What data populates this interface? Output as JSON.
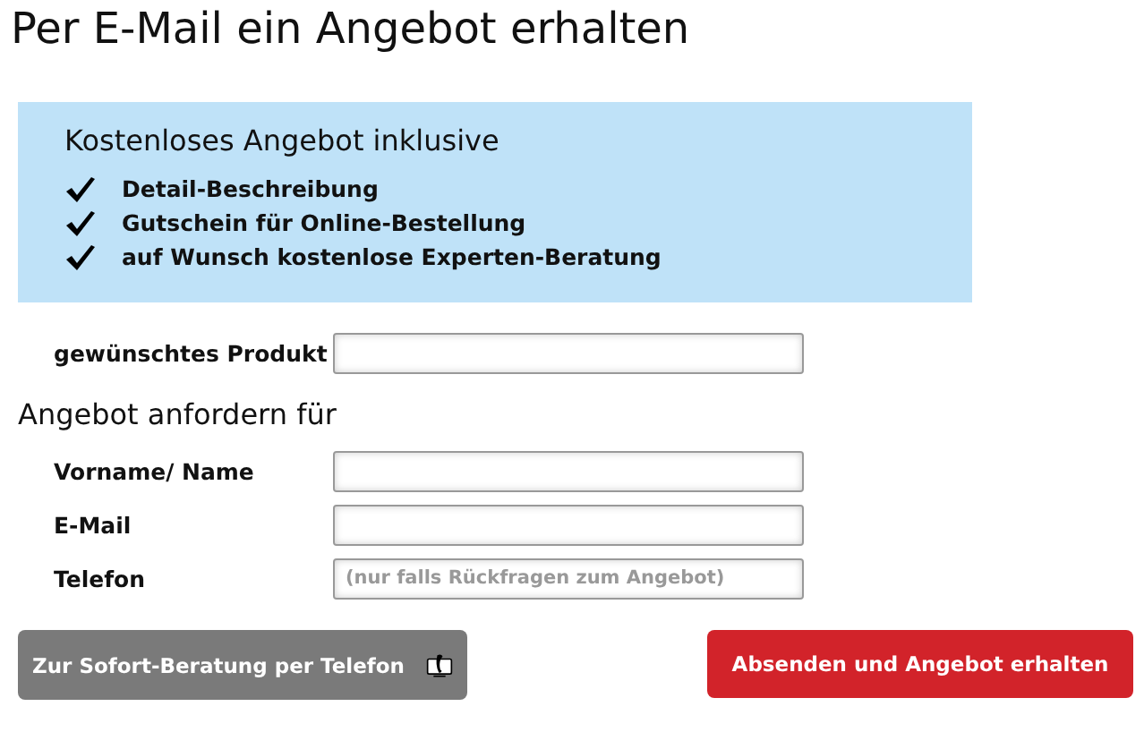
{
  "title": "Per E-Mail ein Angebot erhalten",
  "benefits": {
    "heading": "Kostenloses Angebot inklusive",
    "items": [
      "Detail-Beschreibung",
      "Gutschein für Online-Bestellung",
      "auf Wunsch kostenlose Experten-Beratung"
    ]
  },
  "product_field": {
    "label": "gewünschtes Produkt"
  },
  "section_heading": "Angebot anfordern für",
  "contact_fields": [
    {
      "label": "Vorname/ Name"
    },
    {
      "label": "E-Mail"
    },
    {
      "label": "Telefon",
      "placeholder": "(nur falls Rückfragen zum Angebot)"
    }
  ],
  "phone_button": "Zur Sofort-Beratung per Telefon",
  "submit_button": "Absenden und Angebot erhalten"
}
